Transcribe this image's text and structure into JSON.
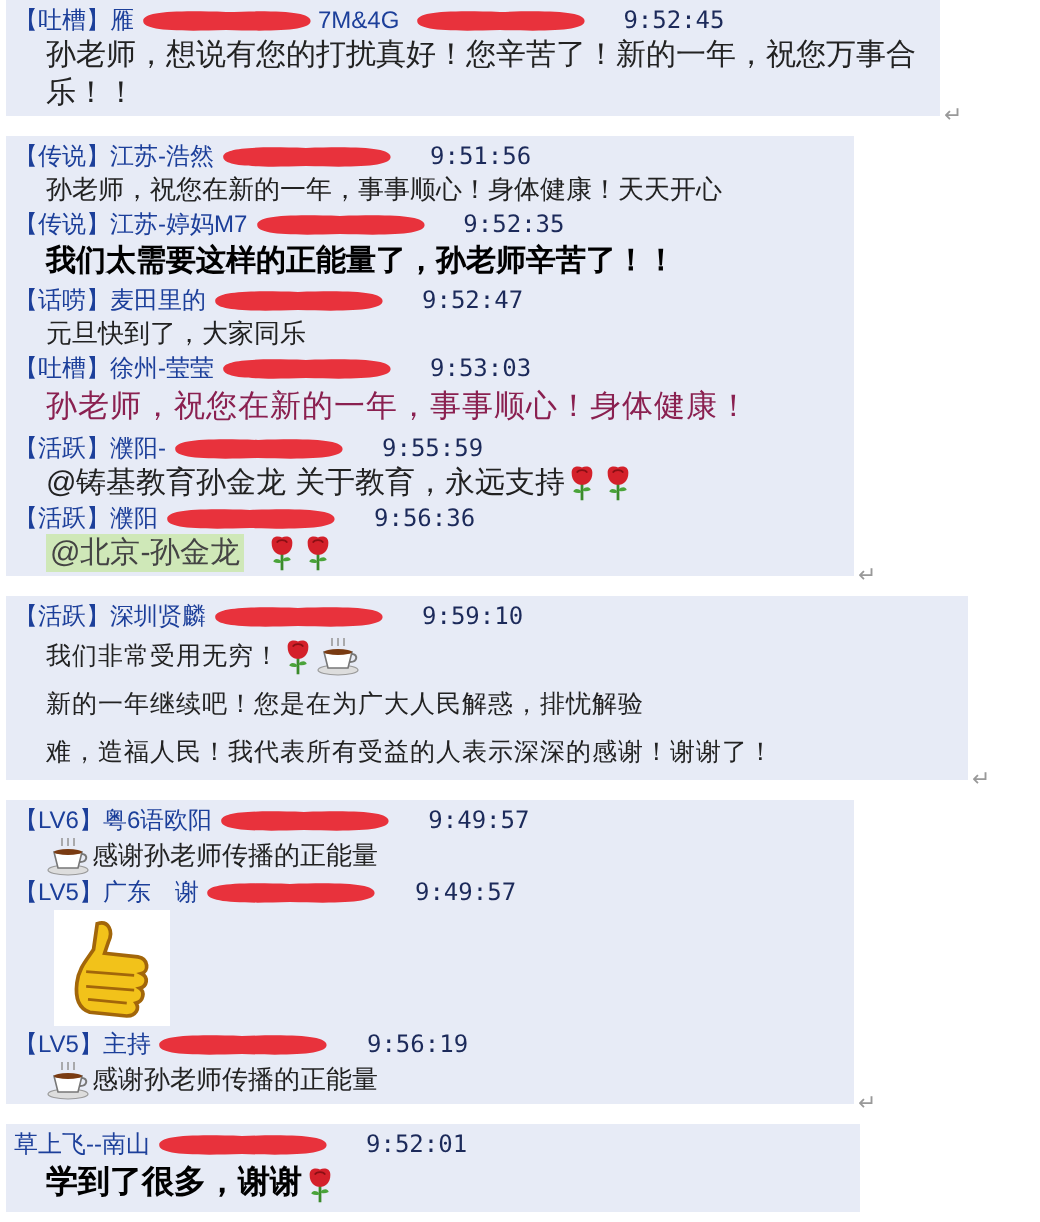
{
  "cards": [
    {
      "end_mark": "↵",
      "messages": [
        {
          "tag": "【吐槽】",
          "name": "雁",
          "name_tail": "7M&4G",
          "time": "9:52:45",
          "body": [
            {
              "kind": "text",
              "text": "孙老师，想说有您的打扰真好！您辛苦了！新的一年，祝您万事合乐！！"
            }
          ]
        }
      ]
    },
    {
      "end_mark": "↵",
      "messages": [
        {
          "tag": "【传说】",
          "name": "江苏-浩然",
          "time": "9:51:56",
          "body": [
            {
              "kind": "text",
              "text": "孙老师，祝您在新的一年，事事顺心！身体健康！天天开心"
            }
          ]
        },
        {
          "tag": "【传说】",
          "name": "江苏-婷妈M7",
          "time": "9:52:35",
          "body": [
            {
              "kind": "text",
              "text": "我们太需要这样的正能量了，孙老师辛苦了！！"
            }
          ]
        },
        {
          "tag": "【话唠】",
          "name": "麦田里的",
          "time": "9:52:47",
          "body": [
            {
              "kind": "text",
              "text": "元旦快到了，大家同乐"
            }
          ]
        },
        {
          "tag": "【吐槽】",
          "name": "徐州-莹莹",
          "time": "9:53:03",
          "body": [
            {
              "kind": "text",
              "text": "孙老师，祝您在新的一年，事事顺心！身体健康！"
            }
          ]
        },
        {
          "tag": "【活跃】",
          "name": "濮阳-",
          "time": "9:55:59",
          "body": [
            {
              "kind": "text",
              "text": "@铸基教育孙金龙 关于教育，永远支持"
            },
            {
              "kind": "rose"
            },
            {
              "kind": "rose"
            }
          ]
        },
        {
          "tag": "【活跃】",
          "name": "濮阳",
          "time": "9:56:36",
          "body": [
            {
              "kind": "mention",
              "text": "@北京-孙金龙"
            },
            {
              "kind": "rose"
            },
            {
              "kind": "rose"
            }
          ]
        }
      ]
    },
    {
      "end_mark": "↵",
      "messages": [
        {
          "tag": "【活跃】",
          "name": "深圳贤麟",
          "time": "9:59:10",
          "body": [
            {
              "kind": "text",
              "text": "我们非常受用无穷！"
            },
            {
              "kind": "rose"
            },
            {
              "kind": "coffee"
            },
            {
              "kind": "text",
              "text": "新的一年继续吧！您是在为广大人民解惑，排忧解验"
            },
            {
              "kind": "text",
              "text": "难，造福人民！我代表所有受益的人表示深深的感谢！谢谢了！"
            }
          ]
        }
      ]
    },
    {
      "end_mark": "↵",
      "messages": [
        {
          "tag": "【LV6】",
          "name": "粤6语欧阳",
          "time": "9:49:57",
          "body": [
            {
              "kind": "coffee"
            },
            {
              "kind": "text",
              "text": "感谢孙老师传播的正能量"
            }
          ]
        },
        {
          "tag": "【LV5】",
          "name": "广东　谢",
          "time": "9:49:57",
          "body": [
            {
              "kind": "sticker"
            }
          ]
        },
        {
          "tag": "【LV5】",
          "name": "主持",
          "time": "9:56:19",
          "body": [
            {
              "kind": "coffee"
            },
            {
              "kind": "text",
              "text": "感谢孙老师传播的正能量"
            }
          ]
        }
      ]
    },
    {
      "messages": [
        {
          "name": "草上飞--南山",
          "time": "9:52:01",
          "body": [
            {
              "kind": "text",
              "text": "学到了很多，谢谢"
            },
            {
              "kind": "rose"
            }
          ]
        }
      ]
    }
  ]
}
